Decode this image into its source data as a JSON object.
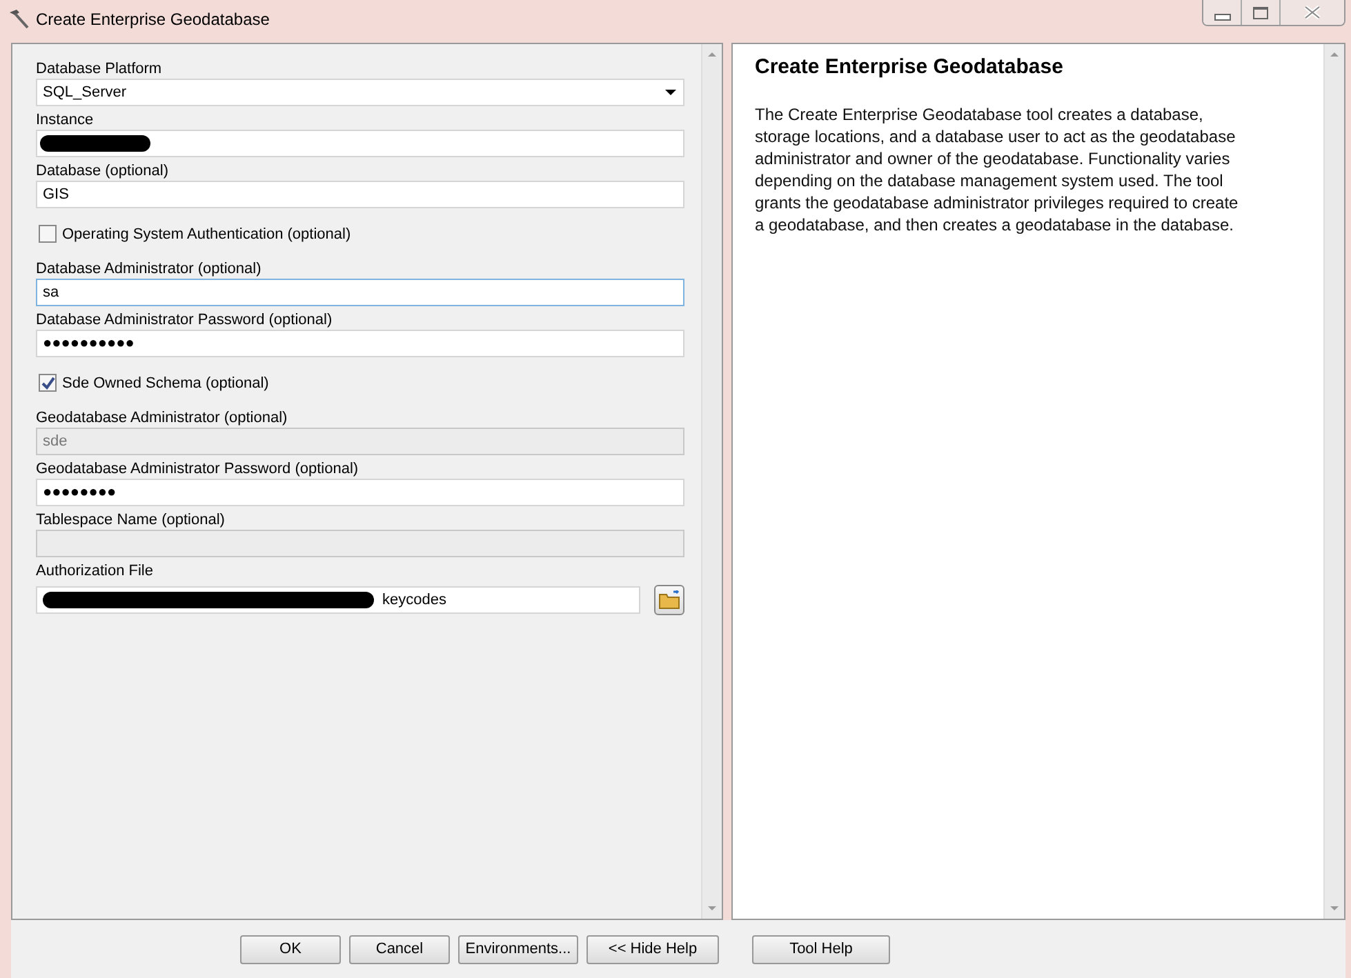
{
  "window": {
    "title": "Create Enterprise Geodatabase"
  },
  "parameters": [
    {
      "kind": "dropdown",
      "label": "Database Platform",
      "value": "SQL_Server",
      "disabled": false,
      "focused": false
    },
    {
      "kind": "text",
      "label": "Instance",
      "redacted": true,
      "disabled": false,
      "focused": false
    },
    {
      "kind": "text",
      "label": "Database (optional)",
      "value": "GIS",
      "disabled": false,
      "focused": false
    },
    {
      "kind": "checkbox",
      "label": "Operating System Authentication (optional)",
      "checked": false
    },
    {
      "kind": "text",
      "label": "Database Administrator (optional)",
      "value": "sa",
      "disabled": false,
      "focused": true
    },
    {
      "kind": "text",
      "label": "Database Administrator Password (optional)",
      "value": "●●●●●●●●●●",
      "disabled": false,
      "focused": false
    },
    {
      "kind": "checkbox",
      "label": "Sde Owned Schema (optional)",
      "checked": true
    },
    {
      "kind": "text",
      "label": "Geodatabase Administrator (optional)",
      "value": "sde",
      "disabled": true,
      "focused": false
    },
    {
      "kind": "text",
      "label": "Geodatabase Administrator Password (optional)",
      "value": "●●●●●●●●",
      "disabled": false,
      "focused": false
    },
    {
      "kind": "text",
      "label": "Tablespace Name (optional)",
      "disabled": true,
      "focused": false
    },
    {
      "kind": "file",
      "label": "Authorization File",
      "value": "keycodes",
      "redacted": true,
      "disabled": false,
      "focused": false
    }
  ],
  "help": {
    "title": "Create Enterprise Geodatabase",
    "text": "The Create Enterprise Geodatabase tool creates a database, storage locations, and a database user to act as the geodatabase administrator and owner of the geodatabase. Functionality varies depending on the database management system used. The tool grants the geodatabase administrator privileges required to create a geodatabase, and then creates a geodatabase in the database."
  },
  "buttons": [
    {
      "label": "OK",
      "kind": "main"
    },
    {
      "label": "Cancel",
      "kind": "main"
    },
    {
      "label": "Environments...",
      "kind": "main"
    },
    {
      "label": "<< Hide Help",
      "kind": "main"
    },
    {
      "label": "Tool Help",
      "kind": "help"
    }
  ]
}
